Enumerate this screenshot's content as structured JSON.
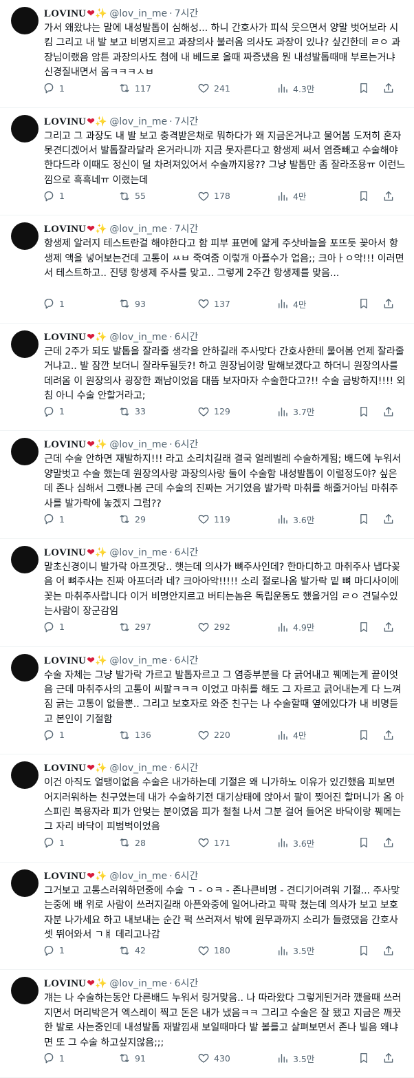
{
  "author": {
    "name": "LOVINU",
    "heart_glyph": "❤",
    "sparkle_glyph": "✨",
    "handle": "@lov_in_me",
    "separator": "·"
  },
  "tweets": [
    {
      "time": "7시간",
      "text": "가서 왜왔냐는 말에 내성발톱이 심해성... 하니 간호사가 피식 웃으면서 양말 벗어보라 시킴 그리고 내 발 보고 비명지르고 과장의사 불러옴 의사도 과장이 있나? 싶긴한데 ㄹㅇ 과장님이랬음 암튼 과장의사도 첨에 내 베드로 올때 짜증냈음 뭔 내성발톱때매 부르는거냐 신경질내면서 옴ㅋㅋㅋㅅㅂ",
      "replies": "1",
      "retweets": "117",
      "likes": "241",
      "views": "4.3만"
    },
    {
      "time": "7시간",
      "text": "그리고 그 과장도 내 발 보고 충격받은채로 뭐하다가 왜 지금온거냐고 물어봄 도저히 혼자 못견디겠어서 발톱잘라달라 온거라니까 지금 못자른다고 항생제 써서 염증빼고 수술해야한다드라 이때도 정신이 덜 차려져있어서 수술까지용?? 그냥 발톱만 좀 잘라조용ㅠ 이런느낌으로 흑흑네ㅠ 이랬는데",
      "replies": "1",
      "retweets": "55",
      "likes": "178",
      "views": "4만"
    },
    {
      "time": "7시간",
      "text": "항생제 알러지 테스트란걸 해야한다고 함 피부 표면에 얇게 주삿바늘을 포뜨듯 꽂아서 항생제 액을 넣어보는건데 고통이 ㅆㅂ 죽여줌 이렇개 아플수가 업음;; 크아ㅏㅇ악!!! 이러면서 테스트하고.. 진탱 항생제 주사를 맞고.. 그렇게 2주간 항생제를 맞음...",
      "replies": "1",
      "retweets": "93",
      "likes": "137",
      "views": "4만"
    },
    {
      "time": "6시간",
      "text": "근데 2주가 되도 발톱을 잘라줄 생각을 안하길래 주사맞다 간호사한테 물어봄 언제 잘라줄거냐고.. 발 잠깐 보더니 잘라두될듯?! 하고 원장님이랑 말해보겠다고 하더니 원장의사를 데려옴 이 원장의사 굉장한 쾌남이었음 대뜸 보자마자 수술한다고?!! 수술 금방하지!!!! 외침 아니 수술 안할거라고;",
      "replies": "1",
      "retweets": "33",
      "likes": "129",
      "views": "3.7만"
    },
    {
      "time": "6시간",
      "text": "근데 수술 안하면 재발하지!!! 라고 소리치길래 결국 얼레벌레 수술하게됨; 배드에 누워서 양말벗고 수술 했는데 원장의사랑 과장의사랑 둘이 수술함 내성발톱이 이럴정도야? 싶은데 존나 심해서 그랬나봄 근데 수술의 진짜는 거기였음 발가락 마취를 해줄거아님 마취주사를 발가락에 놓겠지 그럼??",
      "replies": "1",
      "retweets": "29",
      "likes": "119",
      "views": "3.6만"
    },
    {
      "time": "6시간",
      "text": "말초신경이니 발가락 아프겟당.. 햇는데 의사가 뼈주사인데? 한마디하고 마취주사 냅다꽂음 어 뼈주사는 진짜 아프더라 네? 크아아악!!!!! 소리 절로나옴 발가락 밑 뼈 마디사이에 꽂는 마취주사랍니다 이거 비명안지르고 버티는놈은 독립운동도 했을거임 ㄹㅇ 견딜수있는사람이 장군감임",
      "replies": "1",
      "retweets": "297",
      "likes": "292",
      "views": "4.9만"
    },
    {
      "time": "6시간",
      "text": "수술 자체는 그냥 발가락 가르고 발톱자르고 그 염증부분을 다 긁어내고 꿰메는게 끝이엇음 근데 마취주사의 고통이 씨팔ㅋㅋㅋ 이었고 마취를 해도 그 자르고 긁어내는게 다 느껴짐 긁는 고통이 없을뿐.. 그리고 보호자로 와준 친구는 나 수술할때 옆에있다가 내 비명듣고 본인이 기절함",
      "replies": "1",
      "retweets": "136",
      "likes": "220",
      "views": "4만"
    },
    {
      "time": "6시간",
      "text": "이건 아직도 얼탱이없음 수술은 내가하는데 기절은 왜 니가하노 이유가 있긴했음 피보면 어지러워하는 친구였는데 내가 수술하기전 대기상태에 앉아서 팔이 찢어진 할머니가 옴 아스피린 복용자라 피가 안멎는 분이였음 피가 철철 나서 그분 걸어 들어온 바닥이랑 꿰메는 그 자리 바닥이 피범벅이었음",
      "replies": "1",
      "retweets": "28",
      "likes": "171",
      "views": "3.6만"
    },
    {
      "time": "6시간",
      "text": "그거보고 고통스러워하던중에 수술 ㄱ - ㅇㅋ - 존나큰비명 - 견디기어려워 기절... 주사맞는중에 배 위로 사람이 쓰러지길래 아픈와중에 일어나라고 팍팍 쳤는데 의사가 보고 보호자분 나가세요 하고 내보내는 순간 퍽 쓰러져서 밖에 원무과까지 소리가 들렸댔음 간호사 셋 뛰어와서 ㄱㅒ 데리고나감",
      "replies": "1",
      "retweets": "42",
      "likes": "180",
      "views": "3.5만"
    },
    {
      "time": "6시간",
      "text": "걔는 나 수술하는동안 다른배드 누워서 링거맞음.. 나 따라왔다 그렇게된거라 깼을때 쓰러지면서 머리박은거 엑스레이 찍고 돈은 내가 냈음ㅋㅋ 그리고 수술은 잘 됐고 지금은 깨끗한 발로 사는중인데 내성발톱 재발낌새 보일때마다 발 볼를고 살펴보면서 존나 빌음 왜냐면 또 그 수술 하고싶지않음;;;",
      "replies": "1",
      "retweets": "91",
      "likes": "430",
      "views": "3.5만"
    }
  ]
}
